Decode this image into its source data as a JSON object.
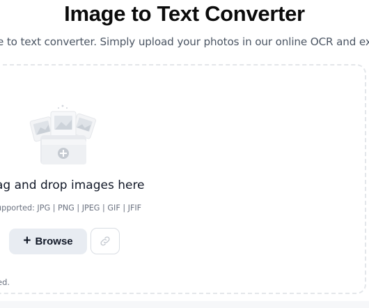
{
  "header": {
    "title": "Image to Text Converter",
    "subtitle": "e to text converter. Simply upload your photos in our online OCR and ex"
  },
  "upload": {
    "illustration_icon": "image-folder-upload-illustration",
    "drop_title": "ag and drop images here",
    "formats": "upported: JPG | PNG | JPEG | GIF | JFIF",
    "browse_label": "Browse",
    "browse_icon": "plus-icon",
    "link_icon": "link-icon",
    "footnote": "ed."
  },
  "colors": {
    "title": "#0b0b0b",
    "subtitle": "#4b5563",
    "browse_bg": "#e8ecf2",
    "border": "#e3e6ea"
  }
}
